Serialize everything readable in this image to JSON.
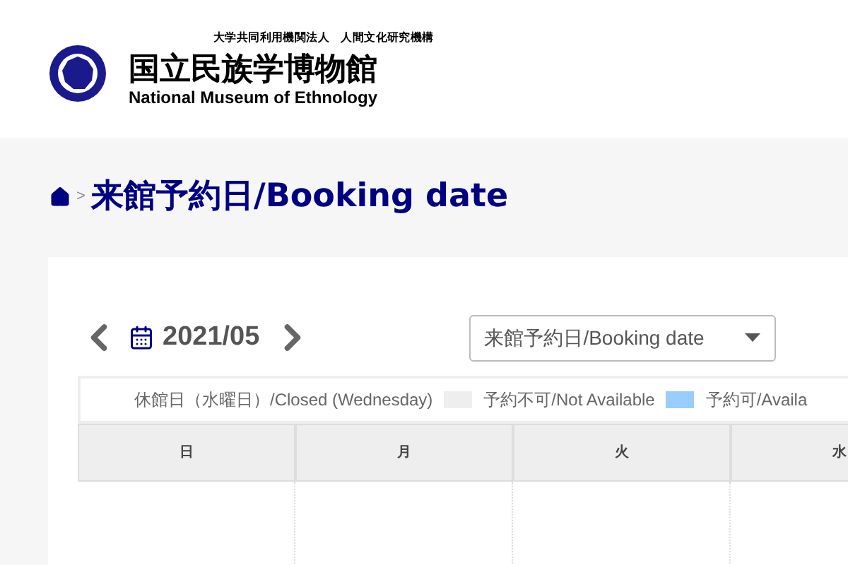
{
  "header": {
    "org": "大学共同利用機関法人　人間文化研究機構",
    "name_ja": "国立民族学博物館",
    "name_en": "National Museum of Ethnology"
  },
  "breadcrumb": {
    "separator": ">",
    "title": "来館予約日/Booking date"
  },
  "calendar": {
    "month": "2021/05",
    "view_select": "来館予約日/Booking date",
    "legend": [
      {
        "label": "休館日（水曜日）/Closed (Wednesday)"
      },
      {
        "label": "予約不可/Not Available",
        "color": "#eeeeee"
      },
      {
        "label": "予約可/Availa",
        "color": "#99ccff"
      }
    ],
    "weekdays": [
      "日",
      "月",
      "火",
      "水"
    ]
  }
}
